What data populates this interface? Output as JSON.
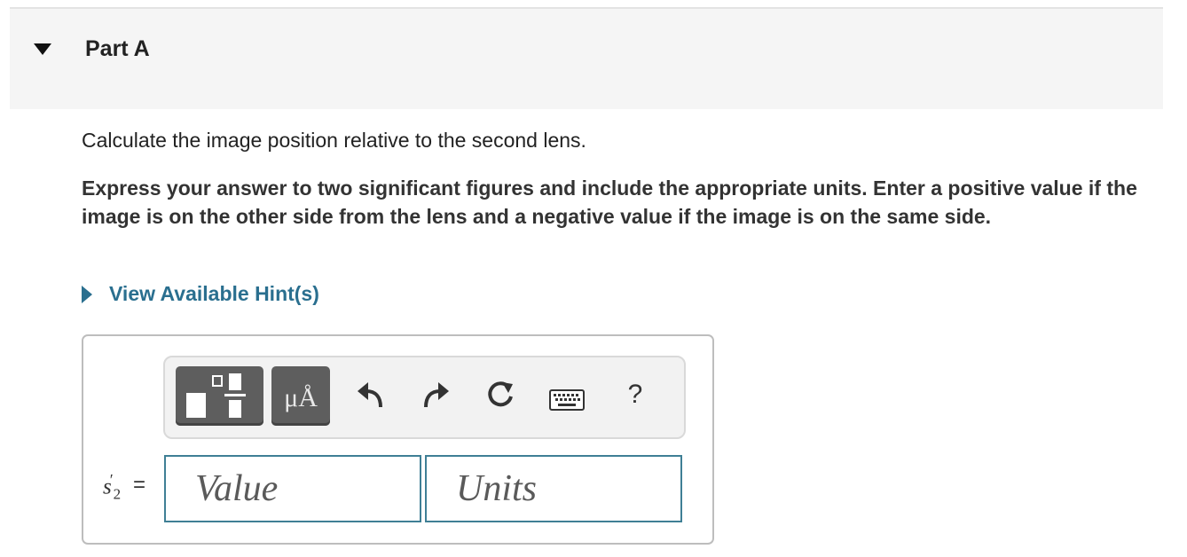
{
  "part": {
    "title": "Part A"
  },
  "question": {
    "prompt": "Calculate the image position relative to the second lens.",
    "instructions": "Express your answer to two significant figures and include the appropriate units. Enter a positive value if the image is on the other side from the lens and a negative value if the image is on the same side."
  },
  "hint": {
    "label": "View Available Hint(s)"
  },
  "toolbar": {
    "units_label": "μÅ",
    "help_label": "?"
  },
  "answer": {
    "variable": "s",
    "subscript": "2",
    "prime": "′",
    "equals": "=",
    "value_placeholder": "Value",
    "units_placeholder": "Units"
  },
  "colors": {
    "accent": "#2a6f8f",
    "field_border": "#3f7f95",
    "toolbar_button": "#5e5e5e",
    "header_bg": "#f5f5f5"
  }
}
